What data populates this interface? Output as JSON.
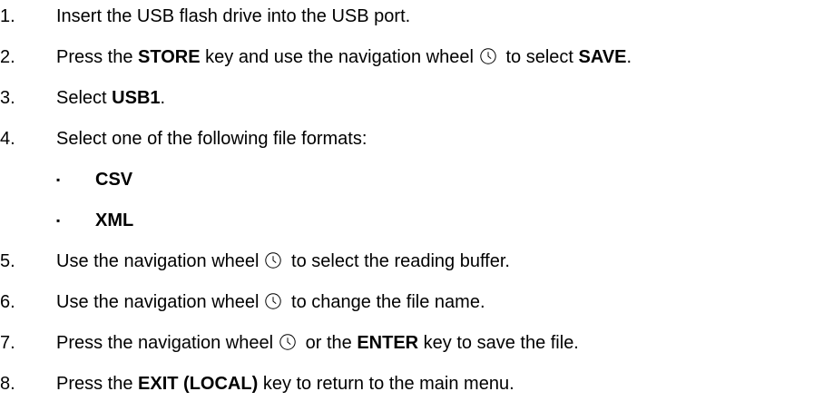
{
  "steps": [
    {
      "num": "1.",
      "parts": [
        {
          "t": "Insert the USB flash drive into the USB port."
        }
      ]
    },
    {
      "num": "2.",
      "parts": [
        {
          "t": "Press the "
        },
        {
          "t": "STORE",
          "b": true
        },
        {
          "t": " key and use the navigation wheel"
        },
        {
          "icon": "navigation-wheel-icon"
        },
        {
          "t": " to select "
        },
        {
          "t": "SAVE",
          "b": true
        },
        {
          "t": "."
        }
      ]
    },
    {
      "num": "3.",
      "parts": [
        {
          "t": "Select "
        },
        {
          "t": "USB1",
          "b": true
        },
        {
          "t": "."
        }
      ]
    },
    {
      "num": "4.",
      "parts": [
        {
          "t": "Select one of the following file formats:"
        }
      ]
    },
    {
      "num": "5.",
      "parts": [
        {
          "t": "Use the navigation wheel"
        },
        {
          "icon": "navigation-wheel-icon"
        },
        {
          "t": " to select the reading buffer."
        }
      ]
    },
    {
      "num": "6.",
      "parts": [
        {
          "t": "Use the navigation wheel"
        },
        {
          "icon": "navigation-wheel-icon"
        },
        {
          "t": " to change the file name."
        }
      ]
    },
    {
      "num": "7.",
      "parts": [
        {
          "t": "Press the navigation wheel"
        },
        {
          "icon": "navigation-wheel-icon"
        },
        {
          "t": " or the "
        },
        {
          "t": "ENTER",
          "b": true
        },
        {
          "t": " key to save the file."
        }
      ]
    },
    {
      "num": "8.",
      "parts": [
        {
          "t": "Press the "
        },
        {
          "t": "EXIT (LOCAL)",
          "b": true
        },
        {
          "t": " key to return to the main menu."
        }
      ]
    }
  ],
  "formats": [
    {
      "bullet": "▪",
      "label": "CSV"
    },
    {
      "bullet": "▪",
      "label": "XML"
    }
  ]
}
